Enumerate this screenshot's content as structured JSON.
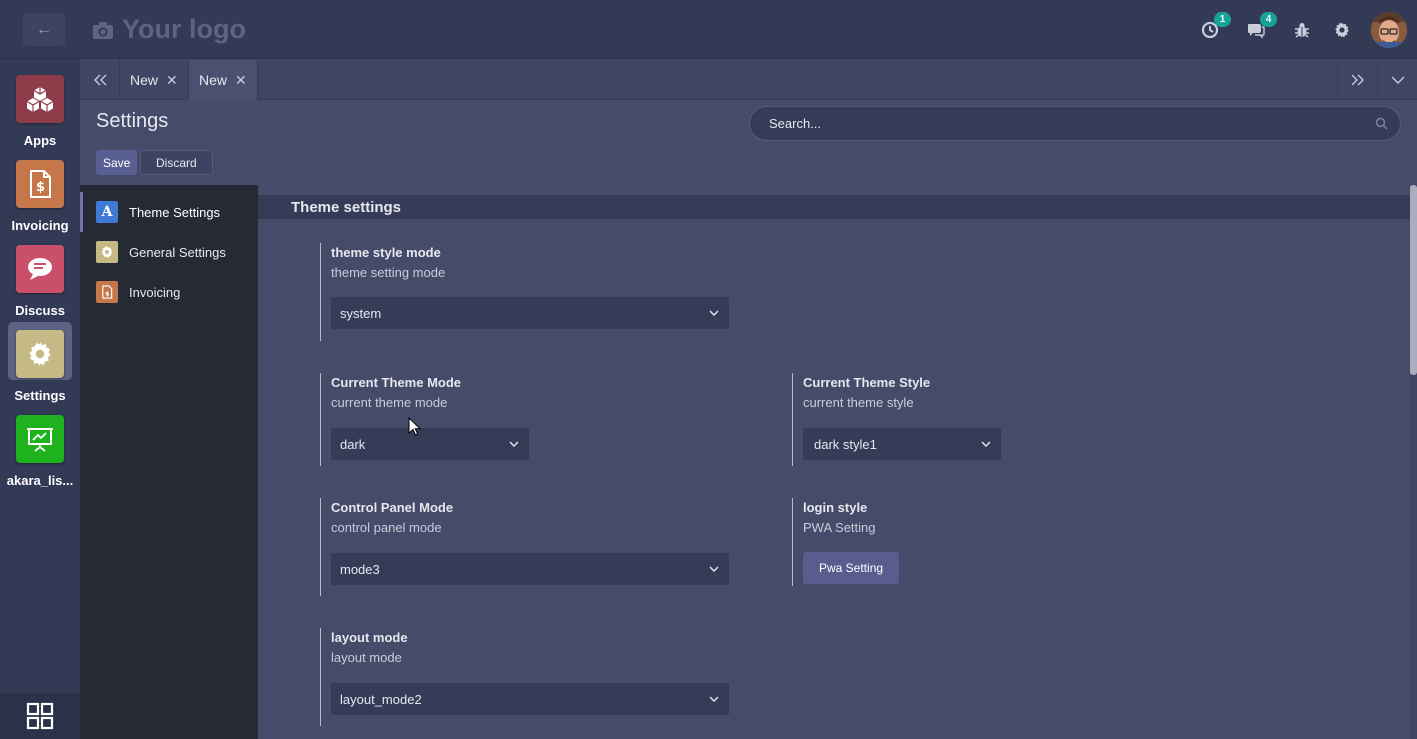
{
  "topbar": {
    "logo_text": "Your logo",
    "activity_badge": "1",
    "messages_badge": "4",
    "icons": [
      "back-arrow-icon",
      "camera-icon",
      "clock-icon",
      "chat-icon",
      "bug-icon",
      "gear-icon",
      "avatar"
    ]
  },
  "apps": [
    {
      "label": "Apps",
      "icon": "cubes-icon",
      "color": "#8e3c4a"
    },
    {
      "label": "Invoicing",
      "icon": "invoice-icon",
      "color": "#c5774a"
    },
    {
      "label": "Discuss",
      "icon": "chat-bubble-icon",
      "color": "#c94f6a"
    },
    {
      "label": "Settings",
      "icon": "gear-icon",
      "color": "#c5b985"
    },
    {
      "label": "akara_lis...",
      "icon": "presentation-icon",
      "color": "#1eb31e"
    }
  ],
  "tabs": [
    {
      "label": "New"
    },
    {
      "label": "New"
    }
  ],
  "control_panel": {
    "title": "Settings",
    "save_label": "Save",
    "discard_label": "Discard",
    "search_placeholder": "Search..."
  },
  "settings_nav": [
    {
      "label": "Theme Settings",
      "icon_text": "A",
      "color": "#3f7bd6"
    },
    {
      "label": "General Settings",
      "icon": "gear-icon",
      "color": "#c5b985"
    },
    {
      "label": "Invoicing",
      "icon": "invoice-icon",
      "color": "#c5774a"
    }
  ],
  "section": {
    "title": "Theme settings"
  },
  "settings": {
    "theme_style_mode": {
      "title": "theme style mode",
      "desc": "theme setting mode",
      "value": "system"
    },
    "current_theme_mode": {
      "title": "Current Theme Mode",
      "desc": "current theme mode",
      "value": "dark"
    },
    "current_theme_style": {
      "title": "Current Theme Style",
      "desc": "current theme style",
      "value": "dark style1"
    },
    "control_panel_mode": {
      "title": "Control Panel Mode",
      "desc": "control panel mode",
      "value": "mode3"
    },
    "login_style": {
      "title": "login style",
      "desc": "PWA Setting",
      "button": "Pwa Setting"
    },
    "layout_mode": {
      "title": "layout mode",
      "desc": "layout mode",
      "value": "layout_mode2"
    }
  }
}
